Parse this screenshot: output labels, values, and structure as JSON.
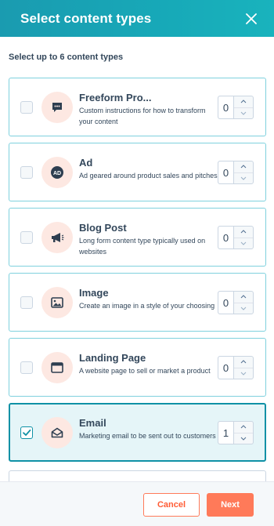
{
  "dialog": {
    "title": "Select content types",
    "subtitle": "Select up to 6 content types"
  },
  "items": [
    {
      "title": "Freeform Pro...",
      "description": "Custom instructions for how to transform your content",
      "count": "0",
      "checked": false,
      "icon": "speech-bubble-icon"
    },
    {
      "title": "Ad",
      "description": "Ad geared around product sales and pitches",
      "count": "0",
      "checked": false,
      "icon": "ad-icon"
    },
    {
      "title": "Blog Post",
      "description": "Long form content type typically used on websites",
      "count": "0",
      "checked": false,
      "icon": "megaphone-icon"
    },
    {
      "title": "Image",
      "description": "Create an image in a style of your choosing",
      "count": "0",
      "checked": false,
      "icon": "image-icon"
    },
    {
      "title": "Landing Page",
      "description": "A website page to sell or market a product",
      "count": "0",
      "checked": false,
      "icon": "browser-window-icon"
    },
    {
      "title": "Email",
      "description": "Marketing email to be sent out to customers",
      "count": "1",
      "checked": true,
      "icon": "envelope-icon"
    }
  ],
  "footer": {
    "cancel_label": "Cancel",
    "next_label": "Next"
  },
  "colors": {
    "header_gradient_start": "#1a9bb0",
    "accent_teal": "#0f91a6",
    "accent_orange": "#ff7a59",
    "icon_bg": "#fde8e2",
    "text_dark": "#33475b"
  }
}
